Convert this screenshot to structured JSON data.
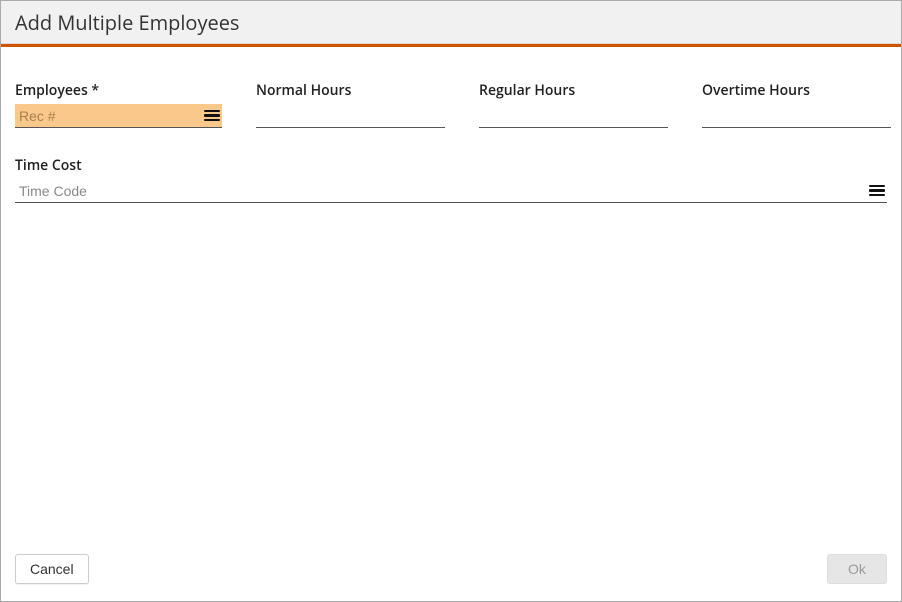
{
  "dialog": {
    "title": "Add Multiple Employees"
  },
  "colors": {
    "accent": "#d35400",
    "highlight": "#f9c88a"
  },
  "fields": {
    "employees": {
      "label": "Employees *",
      "placeholder": "Rec #",
      "value": ""
    },
    "normal_hours": {
      "label": "Normal Hours",
      "value": ""
    },
    "regular_hours": {
      "label": "Regular Hours",
      "value": ""
    },
    "overtime_hours": {
      "label": "Overtime Hours",
      "value": ""
    },
    "time_cost": {
      "label": "Time Cost",
      "placeholder": "Time Code",
      "value": ""
    }
  },
  "buttons": {
    "cancel": "Cancel",
    "ok": "Ok"
  }
}
